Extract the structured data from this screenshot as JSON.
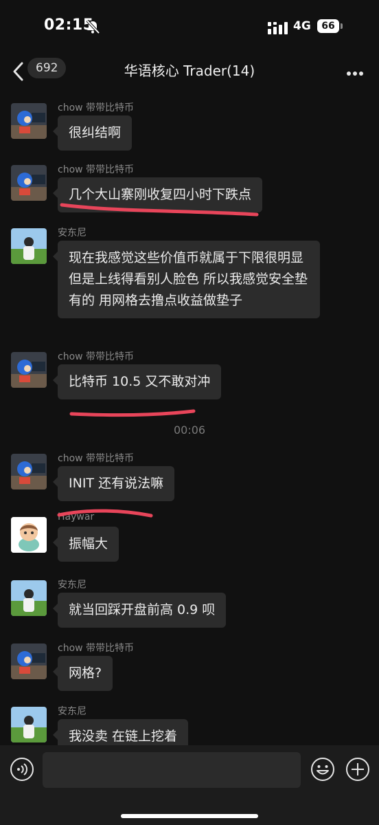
{
  "status_bar": {
    "time": "02:15",
    "network": "4G",
    "battery": "66"
  },
  "header": {
    "back_count": "692",
    "title": "华语核心 Trader(14)"
  },
  "messages": [
    {
      "sender": "chow 带带比特币",
      "text": "很纠结啊",
      "avatar": "sonic-avatar"
    },
    {
      "sender": "chow 带带比特币",
      "text": "几个大山寨刚收复四小时下跌点",
      "avatar": "sonic-avatar"
    },
    {
      "sender": "安东尼",
      "text": "现在我感觉这些价值币就属于下限很明显 但是上线得看别人脸色 所以我感觉安全垫有的 用网格去撸点收益做垫子",
      "avatar": "field-avatar"
    },
    {
      "sender": "chow 带带比特币",
      "text": "比特币 10.5  又不敢对冲",
      "avatar": "sonic-avatar"
    },
    {
      "sender": "chow 带带比特币",
      "text": "INIT 还有说法嘛",
      "avatar": "sonic-avatar"
    },
    {
      "sender": "Haywar",
      "text": "振幅大",
      "avatar": "cartoon-avatar"
    },
    {
      "sender": "安东尼",
      "text": "就当回踩开盘前高 0.9 呗",
      "avatar": "field-avatar"
    },
    {
      "sender": "chow 带带比特币",
      "text": "网格?",
      "avatar": "sonic-avatar"
    },
    {
      "sender": "安东尼",
      "text": "我没卖 在链上挖着",
      "avatar": "field-avatar"
    }
  ],
  "timestamp": "00:06",
  "input": {
    "placeholder": ""
  },
  "colors": {
    "background": "#111111",
    "bubble": "#2c2c2c",
    "annotation": "#e8455a"
  }
}
